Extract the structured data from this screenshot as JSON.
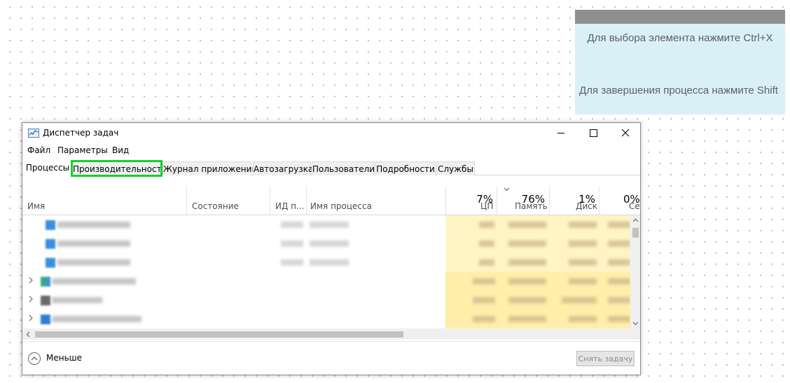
{
  "hint": {
    "select_text": "Для выбора элемента нажмите Ctrl+X",
    "end_text": "Для завершения процесса нажмите Shift"
  },
  "window": {
    "title": "Диспетчер задач",
    "icon": "task-manager-icon"
  },
  "menu": [
    "Файл",
    "Параметры",
    "Вид"
  ],
  "tabs": [
    {
      "label": "Процессы",
      "active": true
    },
    {
      "label": "Производительность",
      "highlighted": true
    },
    {
      "label": "Журнал приложений"
    },
    {
      "label": "Автозагрузка"
    },
    {
      "label": "Пользователи"
    },
    {
      "label": "Подробности"
    },
    {
      "label": "Службы"
    }
  ],
  "columns": {
    "name": "Имя",
    "status": "Состояние",
    "pid": "ИД п...",
    "process_name": "Имя процесса",
    "cpu": {
      "label": "ЦП",
      "value": "7%"
    },
    "memory": {
      "label": "Память",
      "value": "76%"
    },
    "disk": {
      "label": "Диск",
      "value": "1%"
    },
    "network": {
      "label": "Сет",
      "value": "0%"
    }
  },
  "footer": {
    "fewer_label": "Меньше",
    "end_task_label": "Снять задачу"
  },
  "colors": {
    "highlight": "#12d12a",
    "metric_bg": "#fff4c4",
    "hint_bg": "#daf0f7"
  }
}
